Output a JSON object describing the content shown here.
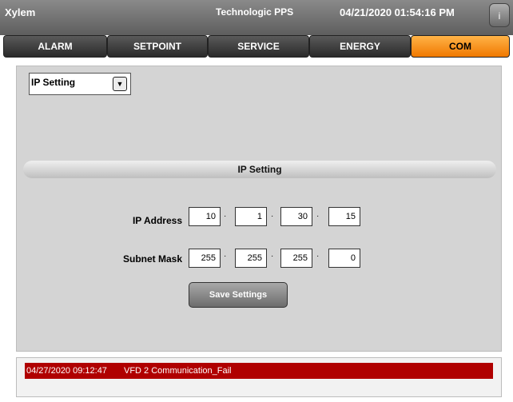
{
  "header": {
    "app_name": "Xylem",
    "station": "Technologic PPS",
    "datetime": "04/21/2020 01:54:16 PM",
    "info_label": "i"
  },
  "tabs": [
    {
      "label": "ALARM",
      "active": false
    },
    {
      "label": "SETPOINT",
      "active": false
    },
    {
      "label": "SERVICE",
      "active": false
    },
    {
      "label": "ENERGY",
      "active": false
    },
    {
      "label": "COM",
      "active": true
    }
  ],
  "dropdown": {
    "selected": "IP Setting",
    "icon": "chevron-down-icon"
  },
  "section": {
    "title": "IP Setting"
  },
  "ip_address": {
    "label": "IP Address",
    "octets": [
      "10",
      "1",
      "30",
      "15"
    ]
  },
  "subnet_mask": {
    "label": "Subnet Mask",
    "octets": [
      "255",
      "255",
      "255",
      "0"
    ]
  },
  "separator": "·",
  "save_button": {
    "label": "Save Settings"
  },
  "alarm": {
    "time": "04/27/2020 09:12:47",
    "message": "VFD 2 Communication_Fail"
  },
  "colors": {
    "active_tab": "#f07800",
    "alarm_bg": "#b00000"
  }
}
